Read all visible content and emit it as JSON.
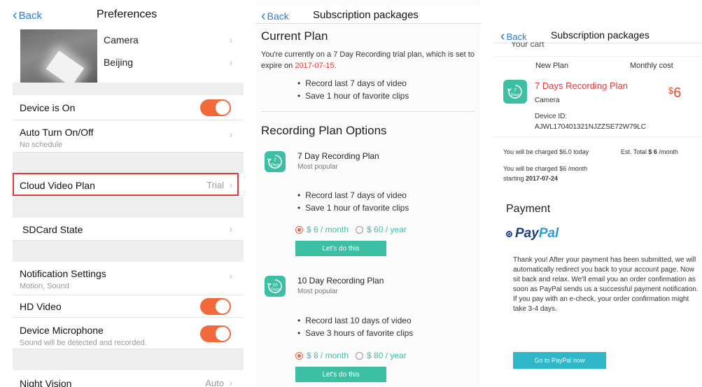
{
  "colors": {
    "accent": "#f26a3a",
    "link": "#2b7cd3",
    "teal": "#3cbfa3",
    "highlight": "#e23a3a",
    "paypal": "#1f3d84"
  },
  "preferences": {
    "back_label": "Back",
    "title": "Preferences",
    "camera_name": "Camera",
    "camera_location": "Beijing",
    "device_on_label": "Device is On",
    "auto_turn_label": "Auto Turn On/Off",
    "auto_turn_sub": "No schedule",
    "cloud_plan_label": "Cloud Video Plan",
    "cloud_plan_value": "Trial",
    "sdcard_label": "SDCard State",
    "notif_label": "Notification Settings",
    "notif_sub": "Motion, Sound",
    "hd_label": "HD Video",
    "mic_label": "Device Microphone",
    "mic_sub": "Sound will be detected and recorded.",
    "night_label": "Night Vision",
    "night_value": "Auto",
    "device_on": true,
    "hd_on": true,
    "mic_on": true
  },
  "subscription": {
    "back_label": "Back",
    "title": "Subscription packages",
    "current_plan_heading": "Current Plan",
    "current_plan_text": "You're currently on a 7 Day Recording trial plan, which is set to expire on ",
    "current_plan_date": "2017-07-15",
    "current_plan_end": ".",
    "current_bullets": [
      "Record last 7 days of video",
      "Save 1 hour of favorite clips"
    ],
    "options_heading": "Recording Plan Options",
    "plans": [
      {
        "name": "7 Day Recording Plan",
        "sub": "Most popular",
        "icon_number": "7",
        "icon_word": "Days",
        "bullets": [
          "Record last 7 days of video",
          "Save 1 hour of favorite clips"
        ],
        "monthly": "$ 6 / month",
        "yearly": "$ 60 / year",
        "button": "Let's do this"
      },
      {
        "name": "10 Day Recording Plan",
        "sub": "Most popular",
        "icon_number": "10",
        "icon_word": "Days",
        "bullets": [
          "Record last 10 days of video",
          "Save 3 hours of favorite clips"
        ],
        "monthly": "$ 8 / month",
        "yearly": "$ 80 / year",
        "button": "Let's do this"
      }
    ]
  },
  "cart": {
    "back_label": "Back",
    "title": "Subscription packages",
    "cut_heading": "Your cart",
    "col_new_plan": "New Plan",
    "col_monthly": "Monthly cost",
    "plan_name": "7 Days Recording Plan",
    "device_name": "Camera",
    "device_id_label": "Device ID:",
    "device_id": "AJWL170401321NJZZSE72W79LC",
    "price_symbol": "$",
    "price_value": "6",
    "charged_today": "You will be charged $6.0 today",
    "est_total_prefix": "Est. Total ",
    "est_total_value": "$ 6",
    "est_total_suffix": " /month",
    "charged_monthly": "You will be charged $6 /month",
    "starting_prefix": "starting ",
    "starting_date": "2017-07-24",
    "payment_heading": "Payment",
    "paypal_pay": "Pay",
    "paypal_pal": "Pal",
    "thanks_text": "Thank you! After your payment has been submitted, we will automatically redirect you back to your account page. Now sit back and relax. We'll email you an order confirmation as soon as PayPal sends us a successful payment notification. If you pay with an e-check, your order confirmation might take 3-4 days.",
    "paypal_button": "Go to PayPal now"
  }
}
